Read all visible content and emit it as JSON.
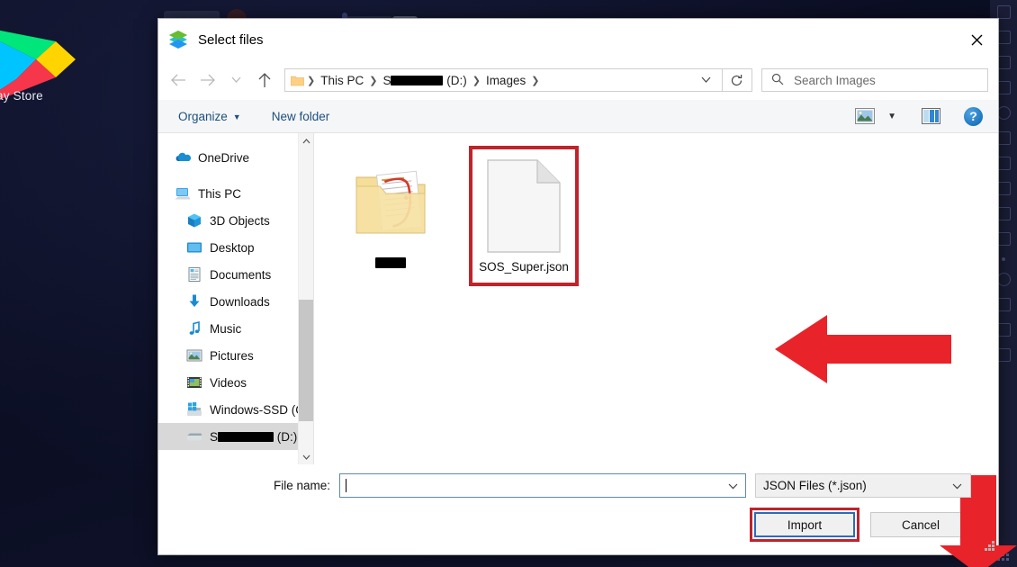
{
  "backdrop": {
    "app_tile_label": "ay Store",
    "app_tile_icon": "google-play-icon"
  },
  "dialog": {
    "title": "Select files",
    "title_icon": "bluestacks-logo-icon",
    "close_icon": "close-icon"
  },
  "nav": {
    "back_icon": "arrow-left-icon",
    "forward_icon": "arrow-right-icon",
    "recent_icon": "chevron-down-icon",
    "up_icon": "arrow-up-icon",
    "refresh_icon": "refresh-icon",
    "breadcrumb_folder_icon": "folder-icon",
    "breadcrumb": [
      {
        "label": "This PC",
        "redacted": false
      },
      {
        "label": " (D:)",
        "redacted": true,
        "redacted_prefix": "S",
        "redact_width": 58
      },
      {
        "label": "Images",
        "redacted": false
      }
    ],
    "breadcrumb_chevron_icon": "chevron-down-icon",
    "search_icon": "search-icon",
    "search_placeholder": "Search Images",
    "search_value": ""
  },
  "command_bar": {
    "organize_label": "Organize",
    "organize_caret_icon": "caret-down-icon",
    "new_folder_label": "New folder",
    "view_icon": "picture-view-icon",
    "view_caret_icon": "caret-down-icon",
    "preview_pane_icon": "preview-pane-icon",
    "help_label": "?",
    "help_icon": "help-icon"
  },
  "sidebar": {
    "scroll_up_icon": "chevron-up-icon",
    "scroll_down_icon": "chevron-down-icon",
    "items": [
      {
        "label": "OneDrive",
        "icon": "onedrive-cloud-icon",
        "indent": false,
        "selected": false,
        "redacted": false
      },
      {
        "label": "This PC",
        "icon": "this-pc-icon",
        "indent": false,
        "selected": false,
        "redacted": false
      },
      {
        "label": "3D Objects",
        "icon": "3d-objects-icon",
        "indent": true,
        "selected": false,
        "redacted": false
      },
      {
        "label": "Desktop",
        "icon": "desktop-icon",
        "indent": true,
        "selected": false,
        "redacted": false
      },
      {
        "label": "Documents",
        "icon": "documents-icon",
        "indent": true,
        "selected": false,
        "redacted": false
      },
      {
        "label": "Downloads",
        "icon": "downloads-icon",
        "indent": true,
        "selected": false,
        "redacted": false
      },
      {
        "label": "Music",
        "icon": "music-icon",
        "indent": true,
        "selected": false,
        "redacted": false
      },
      {
        "label": "Pictures",
        "icon": "pictures-icon",
        "indent": true,
        "selected": false,
        "redacted": false
      },
      {
        "label": "Videos",
        "icon": "videos-icon",
        "indent": true,
        "selected": false,
        "redacted": false
      },
      {
        "label": "Windows-SSD (C",
        "icon": "windows-drive-icon",
        "indent": true,
        "selected": false,
        "redacted": false
      },
      {
        "label": " (D:)",
        "icon": "drive-icon",
        "indent": true,
        "selected": true,
        "redacted": true,
        "redacted_prefix": "S",
        "redact_width": 62
      }
    ]
  },
  "files": [
    {
      "name": "",
      "icon": "folder-with-documents-icon",
      "redacted": true,
      "redact_width": 34,
      "marked": false
    },
    {
      "name": "SOS_Super.json",
      "icon": "generic-file-icon",
      "redacted": false,
      "marked": true
    }
  ],
  "annotations": {
    "arrow_left": "red-left-arrow-annotation",
    "arrow_down": "red-down-arrow-annotation",
    "highlight_color": "#c0232b"
  },
  "footer": {
    "file_name_label": "File name:",
    "file_name_value": "",
    "file_name_chevron_icon": "chevron-down-icon",
    "file_type_value": "JSON Files (*.json)",
    "file_type_chevron_icon": "chevron-down-icon",
    "import_label": "Import",
    "cancel_label": "Cancel"
  }
}
